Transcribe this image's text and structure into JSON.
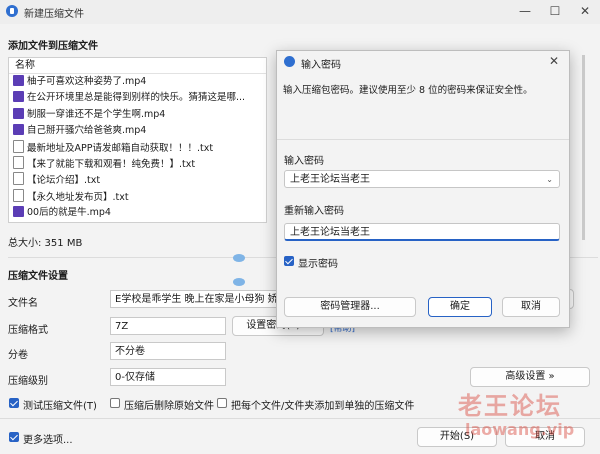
{
  "window": {
    "title": "新建压缩文件",
    "minimize_icon": "—",
    "maximize_icon": "☐",
    "close_icon": "✕"
  },
  "files_section": {
    "heading": "添加文件到压缩文件",
    "column_header": "名称",
    "files": [
      {
        "name": "柚子可喜欢这种姿势了.mp4",
        "type": "mp4"
      },
      {
        "name": "在公开环境里总是能得到别样的快乐。猜猜这是哪...",
        "type": "mp4"
      },
      {
        "name": "制服一穿谁还不是个学生啊.mp4",
        "type": "mp4"
      },
      {
        "name": "自己掰开骚穴给爸爸爽.mp4",
        "type": "mp4"
      },
      {
        "name": "最新地址及APP请发邮箱自动获取！！！.txt",
        "type": "txt"
      },
      {
        "name": "【来了就能下载和观看！纯免费！】.txt",
        "type": "txt"
      },
      {
        "name": "【论坛介绍】.txt",
        "type": "txt"
      },
      {
        "name": "【永久地址发布页】.txt",
        "type": "txt"
      },
      {
        "name": "00后的就是牛.mp4",
        "type": "mp4"
      }
    ],
    "total_size": "总大小: 351 MB"
  },
  "settings": {
    "heading": "压缩文件设置",
    "filename_label": "文件名",
    "filename_value": "E学校是乖学生 晚上在家是小母狗 娇小可",
    "format_label": "压缩格式",
    "format_value": "7Z",
    "password_btn": "设置密码(P)...",
    "password_link": "[帮助]",
    "split_label": "分卷",
    "split_value": "不分卷",
    "level_label": "压缩级别",
    "level_value": "0-仅存储",
    "advanced_btn": "高级设置 »",
    "test_checkbox": "测试压缩文件(T)",
    "delete_checkbox": "压缩后删除原始文件",
    "each_checkbox": "把每个文件/文件夹添加到单独的压缩文件",
    "more_checkbox": "更多选项...",
    "start_btn": "开始(S)",
    "cancel_btn": "取消",
    "browse_dots": "..."
  },
  "dialog": {
    "title": "输入密码",
    "description": "输入压缩包密码。建议使用至少 8 位的密码来保证安全性。",
    "password_label": "输入密码",
    "password_value": "上老王论坛当老王",
    "confirm_label": "重新输入密码",
    "confirm_value": "上老王论坛当老王",
    "show_password": "显示密码",
    "manager_btn": "密码管理器...",
    "ok_btn": "确定",
    "cancel_btn": "取消"
  },
  "watermark": {
    "line1": "老王论坛",
    "line2": "laowang.vip"
  },
  "colors": {
    "accent": "#2762c5",
    "video_icon": "#5b3db5",
    "watermark": "#d94a3f"
  }
}
